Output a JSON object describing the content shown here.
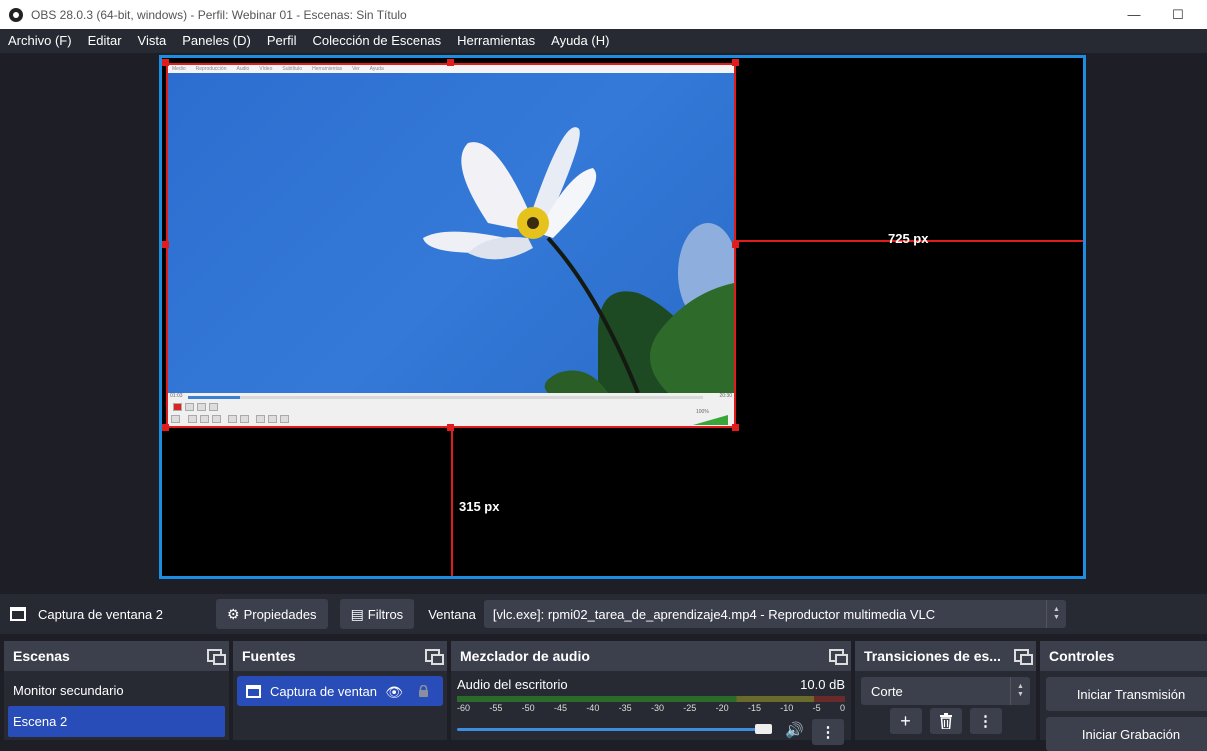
{
  "window": {
    "title": "OBS 28.0.3 (64-bit, windows) - Perfil: Webinar 01 - Escenas: Sin Título",
    "minimize_glyph": "—",
    "maximize_glyph": "☐"
  },
  "menu": {
    "items": [
      "Archivo (F)",
      "Editar",
      "Vista",
      "Paneles (D)",
      "Perfil",
      "Colección de Escenas",
      "Herramientas",
      "Ayuda (H)"
    ]
  },
  "preview": {
    "guide_right_label": "725 px",
    "guide_bottom_label": "315 px",
    "vlc_menu": [
      "Medio",
      "Reproducción",
      "Audio",
      "Vídeo",
      "Subtítulo",
      "Herramientas",
      "Ver",
      "Ayuda"
    ],
    "vlc_time_left": "01:03",
    "vlc_time_right": "20:30",
    "vlc_volume": "100%"
  },
  "context_bar": {
    "source_name": "Captura de ventana 2",
    "properties_label": "Propiedades",
    "filters_label": "Filtros",
    "window_label": "Ventana",
    "window_value": "[vlc.exe]: rpmi02_tarea_de_aprendizaje4.mp4 - Reproductor multimedia VLC"
  },
  "docks": {
    "scenes": {
      "title": "Escenas",
      "items": [
        "Monitor secundario",
        "Escena 2"
      ]
    },
    "sources": {
      "title": "Fuentes",
      "items": [
        "Captura de ventan"
      ]
    },
    "mixer": {
      "title": "Mezclador de audio",
      "channel_name": "Audio del escritorio",
      "level": "10.0 dB",
      "scale": [
        "-60",
        "-55",
        "-50",
        "-45",
        "-40",
        "-35",
        "-30",
        "-25",
        "-20",
        "-15",
        "-10",
        "-5",
        "0"
      ],
      "volume_fraction": 0.97
    },
    "transitions": {
      "title": "Transiciones de es...",
      "selected": "Corte"
    },
    "controls": {
      "title": "Controles",
      "start_streaming": "Iniciar Transmisión",
      "start_recording": "Iniciar Grabación"
    }
  },
  "colors": {
    "accent_blue": "#1c8de0",
    "selection_red": "#e01c1c",
    "active_item": "#284cb8",
    "panel_bg": "#272a33",
    "header_bg": "#3c404d"
  }
}
